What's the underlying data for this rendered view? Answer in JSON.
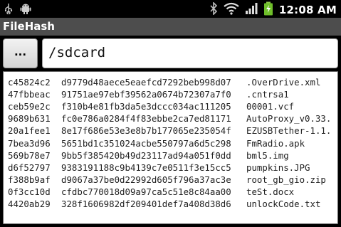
{
  "statusbar": {
    "time": "12:08 AM",
    "icons": [
      "usb-icon",
      "android-debug-icon",
      "bluetooth-icon",
      "wifi-icon",
      "signal-icon",
      "battery-charging-icon"
    ]
  },
  "app": {
    "title": "FileHash"
  },
  "toolbar": {
    "browse_label": "...",
    "path_value": "/sdcard"
  },
  "files": [
    {
      "crc": "c45824c2",
      "md5": "d9779d48aece5eaefcd7292beb998d07",
      "name": ".OverDrive.xml"
    },
    {
      "crc": "47fbbeac",
      "md5": "91751ae97ebf39562a0674b72307a7f0",
      "name": ".cntrsa1"
    },
    {
      "crc": "ceb59e2c",
      "md5": "f310b4e81fb3da5e3dccc034ac111205",
      "name": "00001.vcf"
    },
    {
      "crc": "9689b631",
      "md5": "fc0e786a0284f4f83ebbe2ca7ed81171",
      "name": "AutoProxy_v0.33."
    },
    {
      "crc": "20a1fee1",
      "md5": "8e17f686e53e3e8b7b177065e235054f",
      "name": "EZUSBTether-1.1."
    },
    {
      "crc": "7bea3d96",
      "md5": "5651bd1c351024acbe550797a6d5c298",
      "name": "FmRadio.apk"
    },
    {
      "crc": "569b78e7",
      "md5": "9bb5f385420b49d23117ad94a051f0dd",
      "name": "bml5.img"
    },
    {
      "crc": "d6f52797",
      "md5": "9383191188c9b4139c7e0511f3e15cc5",
      "name": "pumpkins.JPG"
    },
    {
      "crc": "f388b9af",
      "md5": "d9067a37be0d22992d605f796a37ac3e",
      "name": "root_gb_gio.zip"
    },
    {
      "crc": "0f3cc10d",
      "md5": "cfdbc770018d09a97ca5c51e8c84aa00",
      "name": "teSt.docx"
    },
    {
      "crc": "4420ab29",
      "md5": "328f1606982df209401def7a408d38d6",
      "name": "unlockCode.txt"
    }
  ]
}
